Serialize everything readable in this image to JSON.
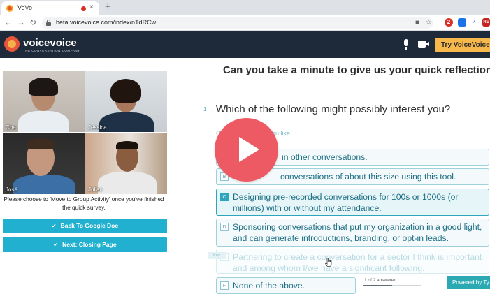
{
  "browser": {
    "tab_title": "VoVo",
    "tab_close": "×",
    "new_tab": "+",
    "back": "←",
    "forward": "→",
    "reload": "↻",
    "url": "beta.voicevoice.com/index/nTdRCw",
    "bookmark_star": "☆",
    "cast_icon": "■",
    "extensions": [
      "2",
      "",
      "✓",
      "RE"
    ]
  },
  "app": {
    "logo_name": "voicevoice",
    "logo_tagline": "THE CONVERSATION COMPANY",
    "try_button": "Try VoiceVoice",
    "brand_color": "#1e2a3a",
    "accent_color": "#f7b84b"
  },
  "participants": [
    {
      "name": "Cha"
    },
    {
      "name": "Jessica"
    },
    {
      "name": "José"
    },
    {
      "name": "Julian"
    }
  ],
  "left_panel": {
    "instruction": "Please choose to 'Move to Group Activity' once you've finished the quick survey.",
    "buttons": [
      {
        "label": "Back To Google Doc"
      },
      {
        "label": "Next: Closing Page"
      }
    ],
    "button_color": "#21b0cf"
  },
  "survey": {
    "heading": "Can you take a minute to give us your quick reflection",
    "question_number": "1 →",
    "question": "Which of the following might possibly interest you?",
    "hint_start": "Ch",
    "hint_end": "ou like",
    "options": [
      {
        "key": "A",
        "text": "in other conversations.",
        "state": "normal"
      },
      {
        "key": "B",
        "text": "conversations of about this size using this tool.",
        "state": "normal"
      },
      {
        "key": "C",
        "text": "Designing pre-recorded conversations for 100s or 1000s (or millions) with or without my attendance.",
        "state": "selected"
      },
      {
        "key": "D",
        "text": "Sponsoring conversations that put my organization in a good light, and can generate introductions, branding, or opt-in leads.",
        "state": "normal"
      },
      {
        "key": "E",
        "text": "Partnering to create a conversation for a sector I think is important and among whom I/we have a significant following.",
        "state": "faded"
      },
      {
        "key": "F",
        "text": "None of the above.",
        "state": "normal"
      }
    ],
    "key_tag": "Key",
    "progress_label": "1 of 2 answered",
    "progress_fraction": 0.5,
    "powered_by": "Powered by Ty"
  },
  "video": {
    "play_icon": "play-icon",
    "play_color": "#ee5a63"
  }
}
